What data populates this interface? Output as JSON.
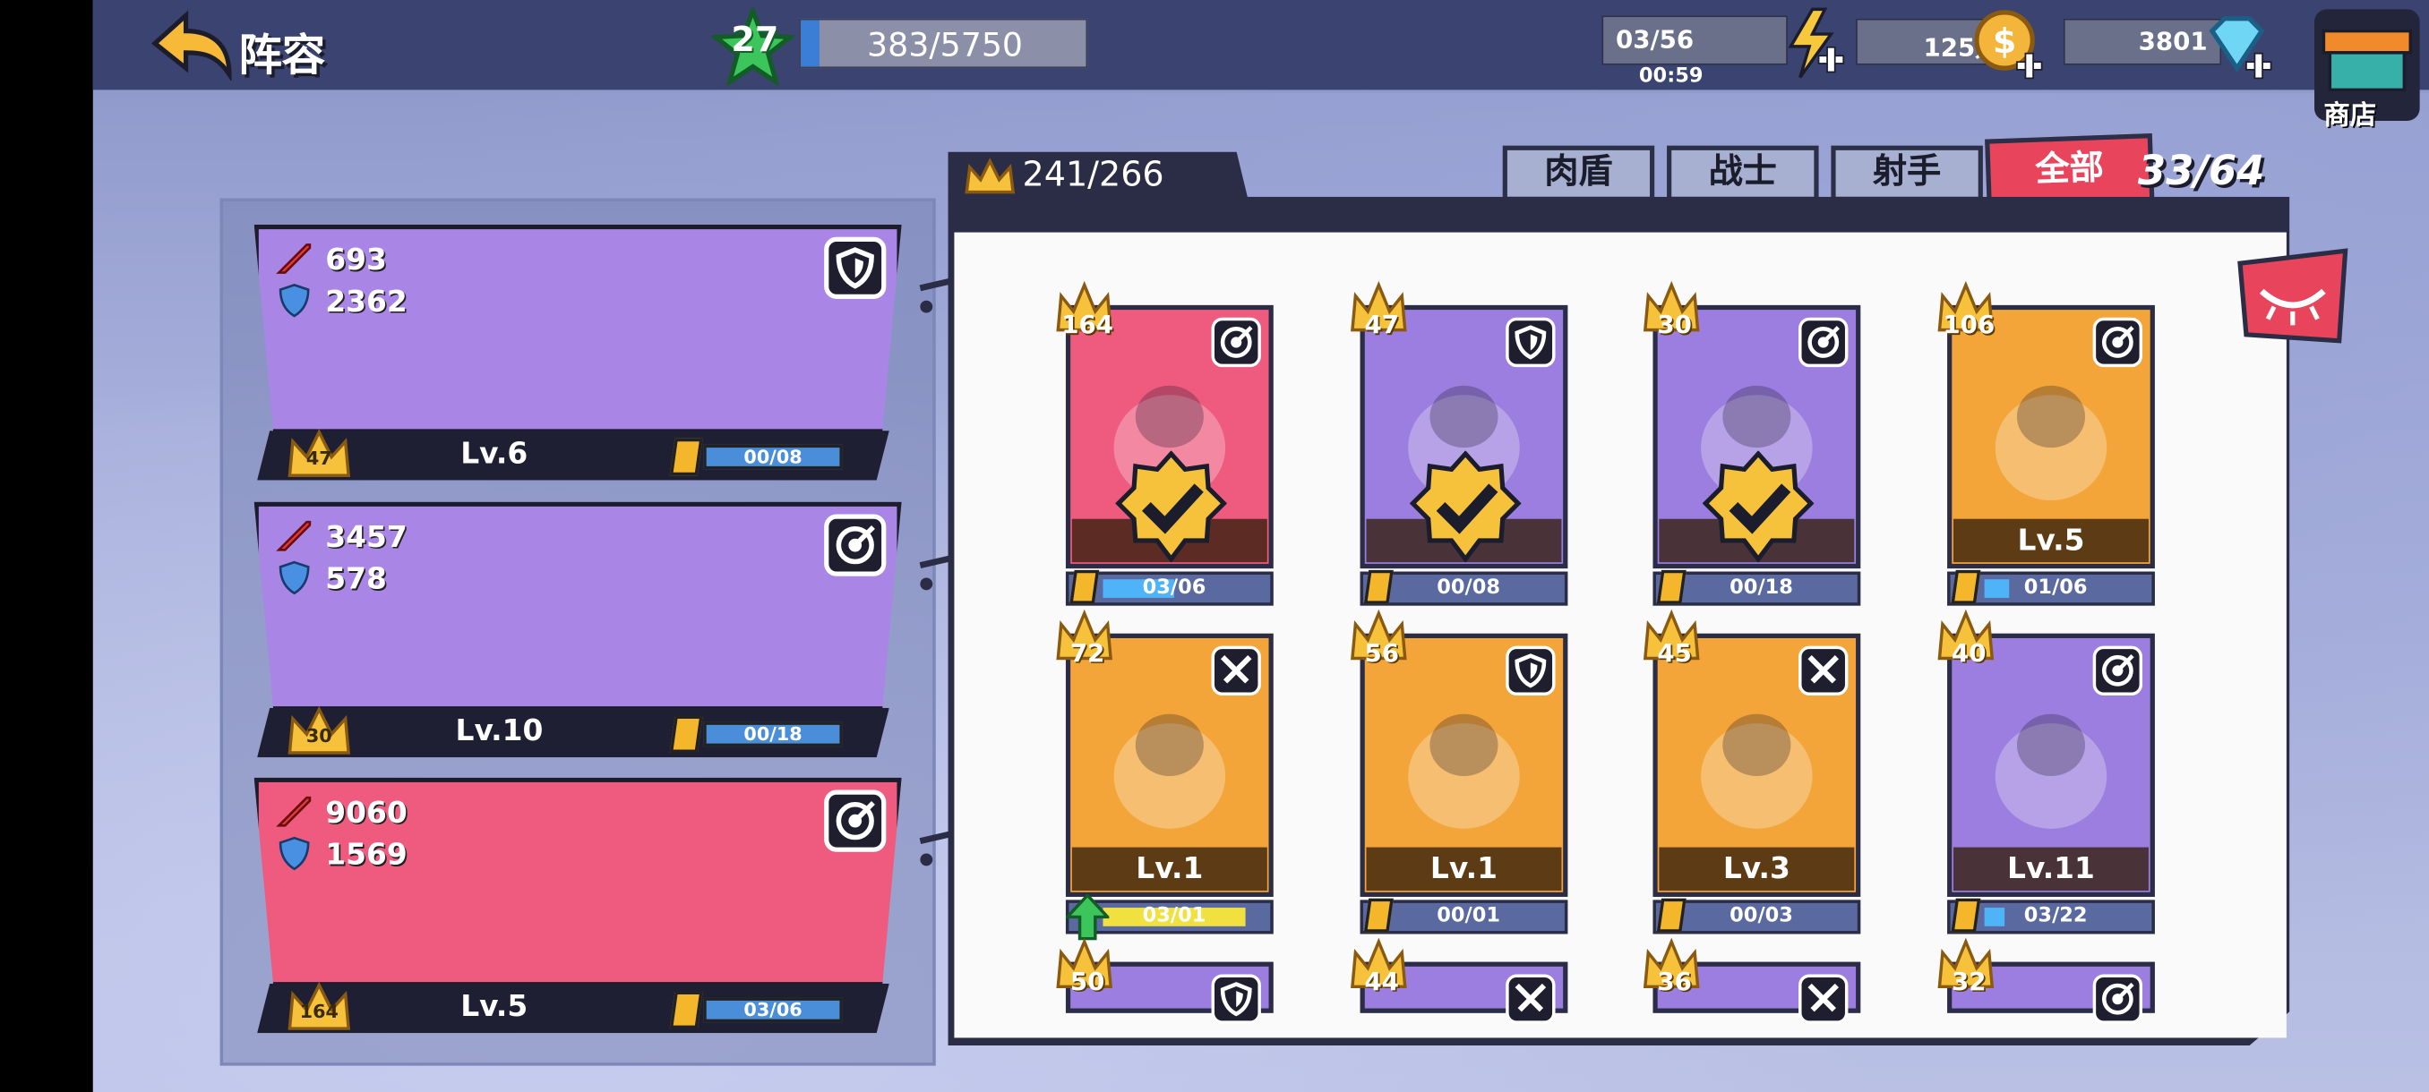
{
  "header": {
    "back_label": "阵容",
    "player_level": "27",
    "exp_text": "383/5750",
    "energy_text": "03/56",
    "energy_timer": "00:59",
    "gold_text": "125万",
    "gem_text": "3801",
    "shop_label": "商店"
  },
  "teams": [
    {
      "atk": "693",
      "def": "2362",
      "lv": "Lv.6",
      "crown": "47",
      "shards": "00/08",
      "role_icon": "shield-icon",
      "color": "#a985e6"
    },
    {
      "atk": "3457",
      "def": "578",
      "lv": "Lv.10",
      "crown": "30",
      "shards": "00/18",
      "role_icon": "target-icon",
      "color": "#a985e6"
    },
    {
      "atk": "9060",
      "def": "1569",
      "lv": "Lv.5",
      "crown": "164",
      "shards": "03/06",
      "role_icon": "target-icon",
      "color": "#ef5a7f"
    }
  ],
  "collection": {
    "crown_total": "241/266",
    "count": "33/64",
    "tabs": [
      "肉盾",
      "战士",
      "射手",
      "全部"
    ],
    "active_tab": "全部"
  },
  "cards": [
    {
      "crown": "164",
      "lv": "",
      "shards": "03/06",
      "progress": 0.5,
      "role_icon": "target-icon",
      "color": "#ef5a7f",
      "selected": true
    },
    {
      "crown": "47",
      "lv": "",
      "shards": "00/08",
      "progress": 0.0,
      "role_icon": "shield-icon",
      "color": "#9c7ee0",
      "selected": true
    },
    {
      "crown": "30",
      "lv": "",
      "shards": "00/18",
      "progress": 0.0,
      "role_icon": "target-icon",
      "color": "#9c7ee0",
      "selected": true
    },
    {
      "crown": "106",
      "lv": "Lv.5",
      "shards": "01/06",
      "progress": 0.17,
      "role_icon": "target-icon",
      "color": "#f3a53a",
      "selected": false
    },
    {
      "crown": "72",
      "lv": "Lv.1",
      "shards": "03/01",
      "progress": 1.0,
      "role_icon": "swords-icon",
      "color": "#f3a53a",
      "selected": false,
      "upgrade": true
    },
    {
      "crown": "56",
      "lv": "Lv.1",
      "shards": "00/01",
      "progress": 0.0,
      "role_icon": "shield-icon",
      "color": "#f3a53a",
      "selected": false
    },
    {
      "crown": "45",
      "lv": "Lv.3",
      "shards": "00/03",
      "progress": 0.0,
      "role_icon": "swords-icon",
      "color": "#f3a53a",
      "selected": false
    },
    {
      "crown": "40",
      "lv": "Lv.11",
      "shards": "03/22",
      "progress": 0.14,
      "role_icon": "target-icon",
      "color": "#9c7ee0",
      "selected": false
    },
    {
      "crown": "50",
      "role_icon": "shield-icon",
      "color": "#9c7ee0"
    },
    {
      "crown": "44",
      "role_icon": "swords-icon",
      "color": "#9c7ee0"
    },
    {
      "crown": "36",
      "role_icon": "swords-icon",
      "color": "#9c7ee0"
    },
    {
      "crown": "32",
      "role_icon": "target-icon",
      "color": "#9c7ee0"
    }
  ]
}
